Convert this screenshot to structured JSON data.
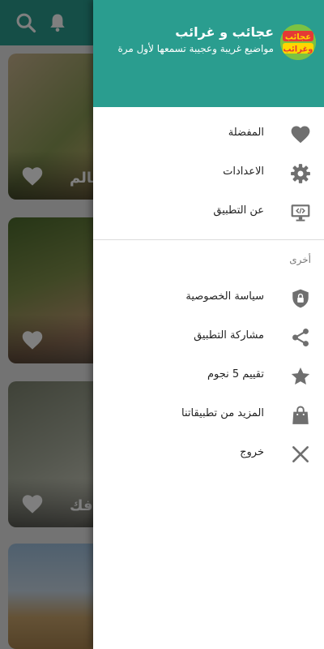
{
  "background": {
    "toolbar": {
      "search_icon": "search-icon",
      "notifications_icon": "bell-icon"
    },
    "cards": [
      {
        "text": "عالم"
      },
      {
        "text": ""
      },
      {
        "text": "ر فك"
      },
      {
        "text": ""
      }
    ]
  },
  "drawer": {
    "header": {
      "logo_text_top": "عجائب",
      "logo_text_bottom": "وغرائب",
      "title": "عجائب و غرائب",
      "subtitle": "مواضيع غريبة وعجيبة تسمعها لأول مرة"
    },
    "primary_items": [
      {
        "label": "المفضلة",
        "icon": "heart-icon"
      },
      {
        "label": "الاعدادات",
        "icon": "gear-icon"
      },
      {
        "label": "عن التطبيق",
        "icon": "monitor-code-icon"
      }
    ],
    "section_label": "أخرى",
    "secondary_items": [
      {
        "label": "سياسة الخصوصية",
        "icon": "shield-lock-icon"
      },
      {
        "label": "مشاركة التطبيق",
        "icon": "share-icon"
      },
      {
        "label": "تقييم 5 نجوم",
        "icon": "star-icon"
      },
      {
        "label": "المزيد من تطبيقاتنا",
        "icon": "shopping-bag-icon"
      },
      {
        "label": "خروج",
        "icon": "close-icon"
      }
    ]
  },
  "colors": {
    "primary": "#2a9d8f",
    "icon_gray": "#6f6f6f",
    "logo_green": "#7cc242",
    "logo_red": "#e53935",
    "logo_yellow": "#ffd600"
  }
}
